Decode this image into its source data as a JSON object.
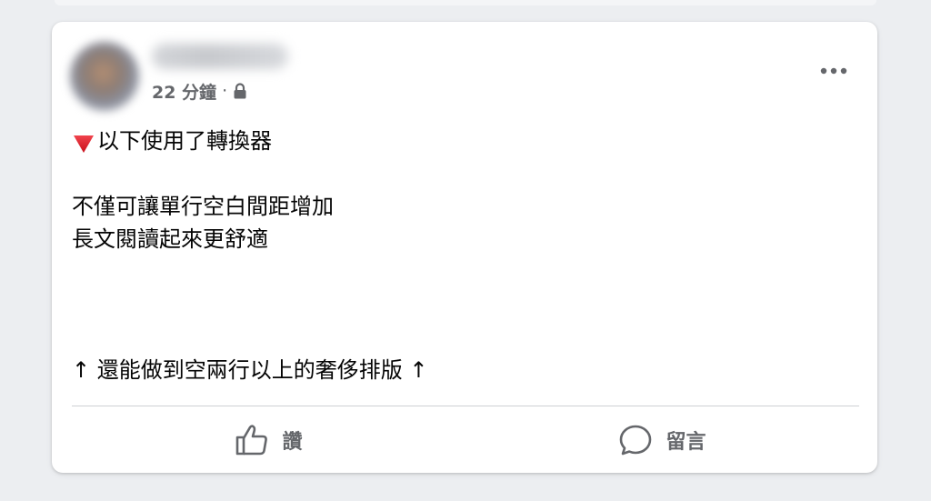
{
  "post": {
    "meta": {
      "time": "22 分鐘",
      "separator": "·",
      "privacy_icon": "lock-icon"
    },
    "more_icon": "more-icon",
    "content": {
      "line1_icon": "red-triangle-down-icon",
      "line1": "以下使用了轉換器",
      "line2": "不僅可讓單行空白間距增加",
      "line3": "長文閱讀起來更舒適",
      "line4": "↑ 還能做到空兩行以上的奢侈排版 ↑"
    },
    "actions": {
      "like_label": "讚",
      "like_icon": "thumbs-up-icon",
      "comment_label": "留言",
      "comment_icon": "comment-icon"
    }
  },
  "colors": {
    "secondary_text": "#65676b",
    "primary_text": "#050505",
    "triangle": "#e0202b",
    "background": "#eceef1",
    "card": "#ffffff"
  }
}
